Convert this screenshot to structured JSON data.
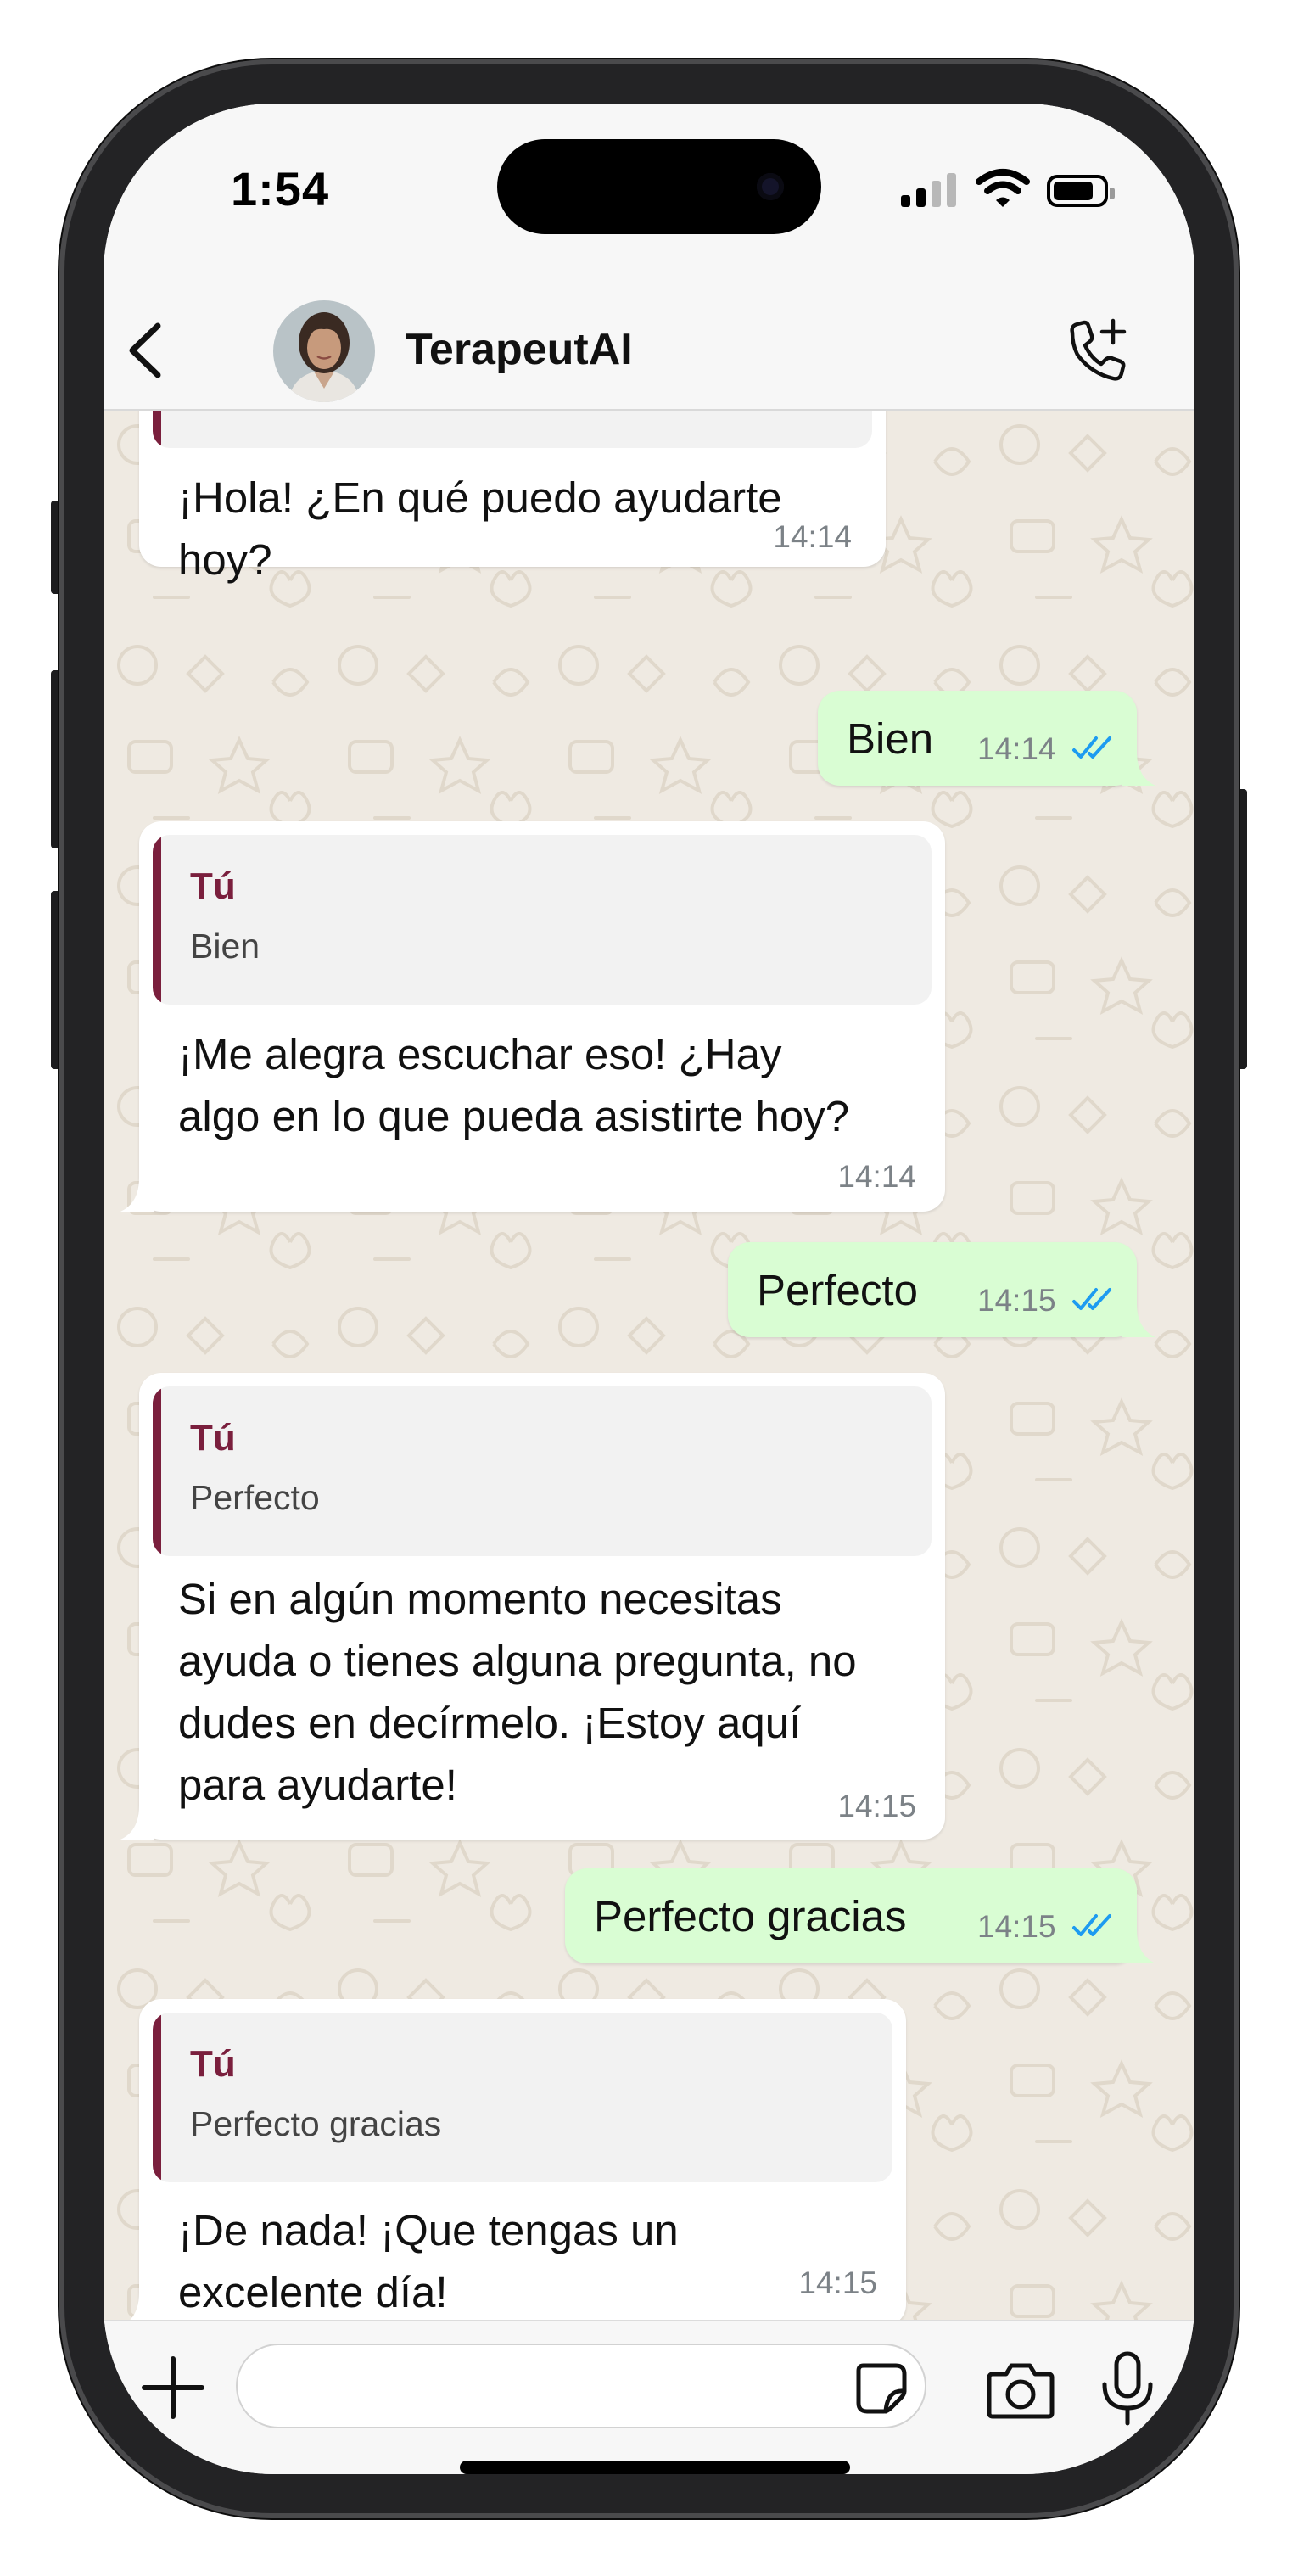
{
  "status_bar": {
    "time": "1:54"
  },
  "header": {
    "contact_name": "TerapeutAI"
  },
  "messages": [
    {
      "direction": "in",
      "text": "¡Hola! ¿En qué puedo ayudarte\nhoy?",
      "time": "14:14"
    },
    {
      "direction": "out",
      "text": "Bien",
      "time": "14:14",
      "read": true
    },
    {
      "direction": "in",
      "quote_author": "Tú",
      "quote_text": "Bien",
      "text": "¡Me alegra escuchar eso! ¿Hay\nalgo en lo que pueda asistirte hoy?",
      "time": "14:14"
    },
    {
      "direction": "out",
      "text": "Perfecto",
      "time": "14:15",
      "read": true
    },
    {
      "direction": "in",
      "quote_author": "Tú",
      "quote_text": "Perfecto",
      "text": "Si en algún momento necesitas\nayuda o tienes alguna pregunta, no\ndudes en decírmelo. ¡Estoy aquí\npara ayudarte!",
      "time": "14:15"
    },
    {
      "direction": "out",
      "text": "Perfecto gracias",
      "time": "14:15",
      "read": true
    },
    {
      "direction": "in",
      "quote_author": "Tú",
      "quote_text": "Perfecto gracias",
      "text": "¡De nada! ¡Que tengas un\nexcelente día!",
      "time": "14:15"
    }
  ],
  "input_bar": {
    "message_value": ""
  },
  "icons": {
    "back": "chevron-left-icon",
    "add_call": "phone-plus-icon",
    "attach": "plus-icon",
    "sticker": "sticker-icon",
    "camera": "camera-icon",
    "mic": "microphone-icon"
  },
  "colors": {
    "outgoing_bubble": "#d9fdd3",
    "incoming_bubble": "#ffffff",
    "chat_background": "#efeae2",
    "quote_accent": "#7a1f3d",
    "read_ticks": "#1d9bf0"
  }
}
